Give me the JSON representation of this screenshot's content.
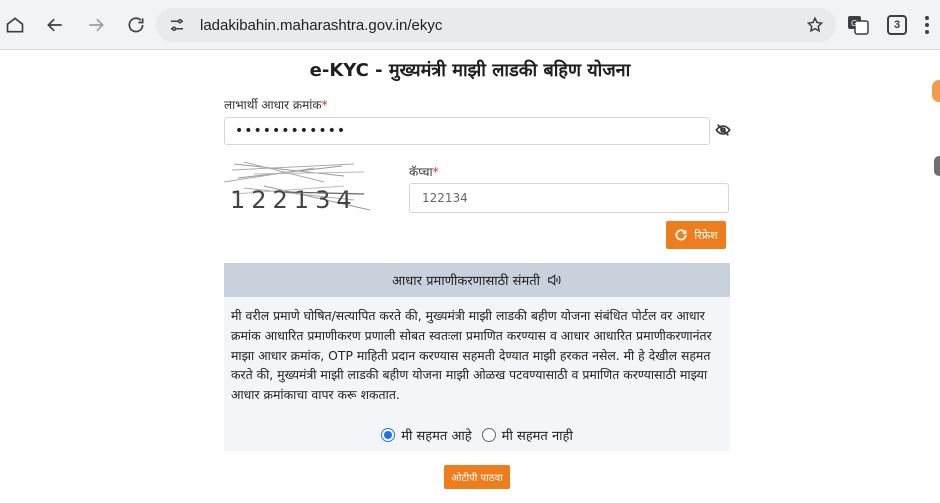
{
  "browser": {
    "url": "ladakibahin.maharashtra.gov.in/ekyc",
    "tab_count": "3"
  },
  "page": {
    "title": "e-KYC - मुख्यमंत्री माझी लाडकी बहिण योजना"
  },
  "form": {
    "aadhaar_label": "लाभार्थी आधार क्रमांक",
    "aadhaar_value": "••••••••••••",
    "required_mark": "*",
    "captcha_text": "122134",
    "captcha_label": "कॅप्चा",
    "captcha_value": "122134",
    "refresh_label": "रिफ्रेश"
  },
  "consent": {
    "header": "आधार प्रमाणीकरणासाठी संमती",
    "text": "मी वरील प्रमाणे घोषित/सत्यापित करते की, मुख्यमंत्री माझी लाडकी बहीण योजना संबंधित पोर्टल वर आधार क्रमांक आधारित प्रमाणीकरण प्रणाली सोबत स्वतःला प्रमाणित करण्यास व आधार आधारित प्रमाणीकरणानंतर माझा आधार क्रमांक, OTP माहिती प्रदान करण्यास सहमती देण्यात माझी हरकत नसेल. मी हे देखील सहमत करते की, मुख्यमंत्री माझी लाडकी बहीण योजना माझी ओळख पटवण्यासाठी व प्रमाणित करण्यासाठी माझ्या आधार क्रमांकाचा वापर करू शकतात.",
    "agree_label": "मी सहमत आहे",
    "disagree_label": "मी सहमत नाही",
    "selected": "agree"
  },
  "actions": {
    "send_otp_label": "ओटीपी पाठवा"
  },
  "colors": {
    "accent": "#ee7d1d",
    "consent_header_bg": "#c9d2dc",
    "radio_selected": "#1a73e8"
  }
}
